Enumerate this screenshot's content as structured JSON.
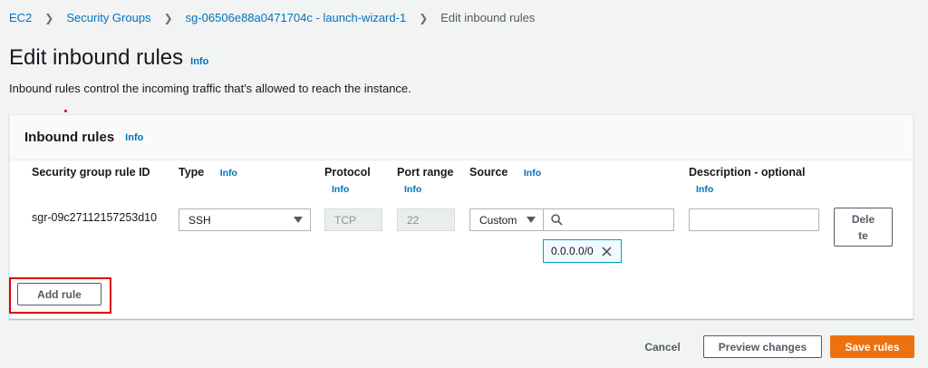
{
  "breadcrumb": {
    "items": [
      "EC2",
      "Security Groups",
      "sg-06506e88a0471704c - launch-wizard-1"
    ],
    "current": "Edit inbound rules"
  },
  "page": {
    "title": "Edit inbound rules",
    "info": "Info",
    "description": "Inbound rules control the incoming traffic that's allowed to reach the instance."
  },
  "panel": {
    "title": "Inbound rules",
    "info": "Info",
    "columns": {
      "rule_id": "Security group rule ID",
      "type": "Type",
      "protocol": "Protocol",
      "port_range": "Port range",
      "source": "Source",
      "description": "Description - optional",
      "info": "Info"
    },
    "rule": {
      "id": "sgr-09c27112157253d10",
      "type": "SSH",
      "protocol": "TCP",
      "port_range": "22",
      "source_type": "Custom",
      "source_search": "",
      "source_token": "0.0.0.0/0",
      "description": "",
      "delete_label_1": "Dele",
      "delete_label_2": "te"
    },
    "add_rule": "Add rule"
  },
  "footer": {
    "cancel": "Cancel",
    "preview": "Preview changes",
    "save": "Save rules"
  },
  "colors": {
    "link": "#0073bb",
    "primary": "#ec7211",
    "highlight": "#e00000"
  }
}
